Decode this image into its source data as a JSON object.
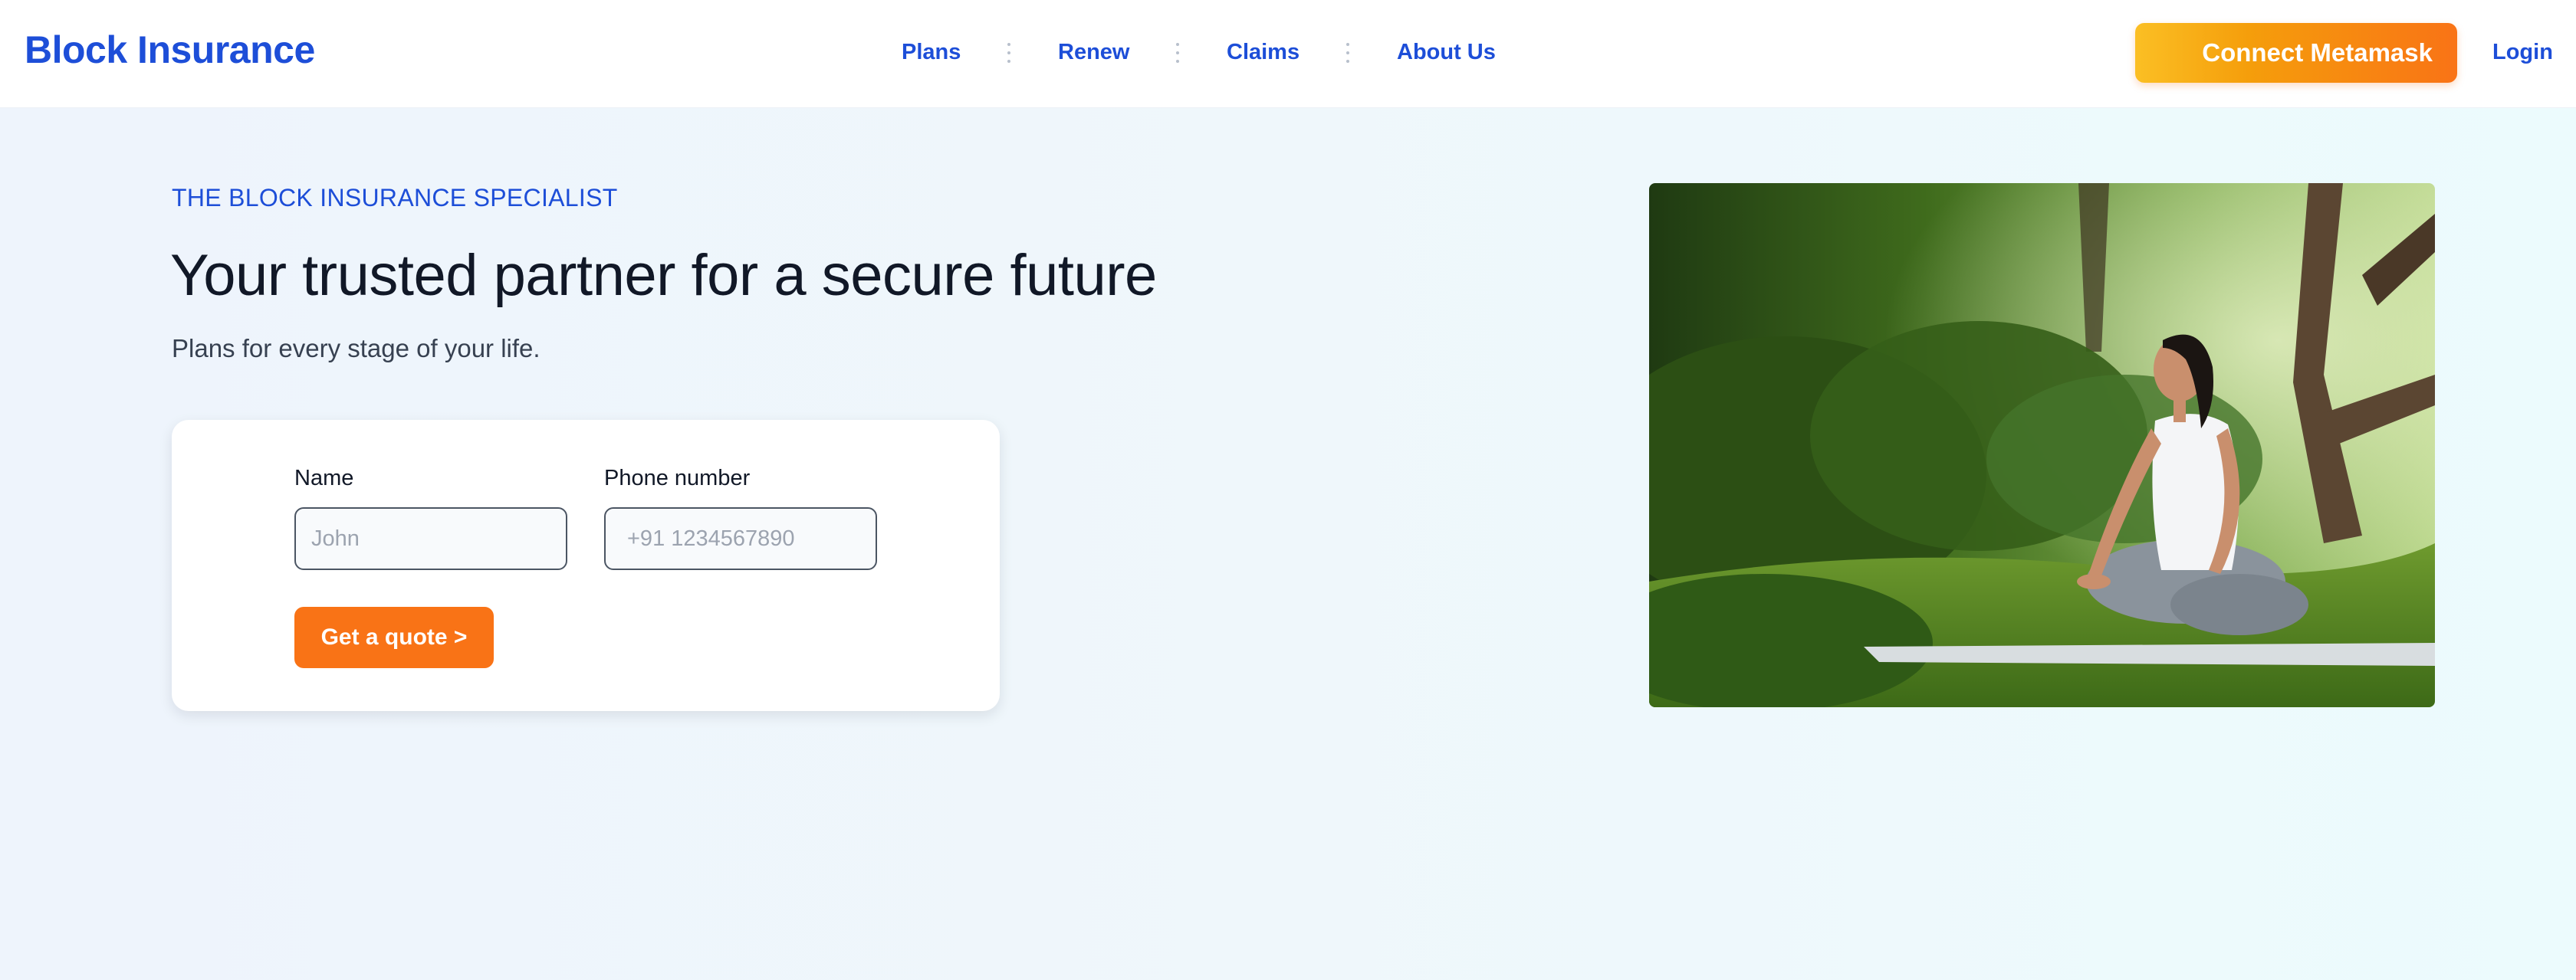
{
  "header": {
    "brand": "Block Insurance",
    "nav": [
      {
        "label": "Plans"
      },
      {
        "label": "Renew"
      },
      {
        "label": "Claims"
      },
      {
        "label": "About Us"
      }
    ],
    "connect_button": "Connect Metamask",
    "login": "Login"
  },
  "hero": {
    "eyebrow": "THE BLOCK INSURANCE SPECIALIST",
    "headline": "Your trusted partner for a secure future",
    "subhead": "Plans for every stage of your life.",
    "form": {
      "name_label": "Name",
      "name_placeholder": "John",
      "name_value": "",
      "phone_label": "Phone number",
      "phone_placeholder": "+91 1234567890",
      "phone_value": "",
      "submit_label": "Get a quote >"
    }
  },
  "colors": {
    "brand_blue": "#1d4ed8",
    "accent_orange": "#f97316",
    "metamask_gradient_start": "#fbbf24",
    "hero_background": "#eef4fc"
  }
}
